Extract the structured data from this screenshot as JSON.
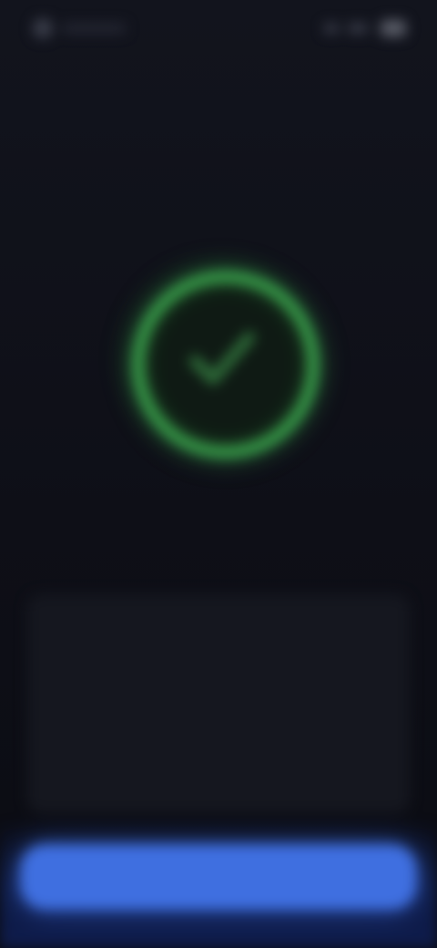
{
  "status_bar": {
    "time": "",
    "indicators": [
      "signal-icon",
      "wifi-icon",
      "battery-icon"
    ]
  },
  "header": {
    "title": ""
  },
  "status_indicator": {
    "icon": "check-circle-icon",
    "caption": ""
  },
  "info_card": {
    "heading": "",
    "body": "",
    "link": ""
  },
  "primary_action": {
    "label": ""
  },
  "colors": {
    "background": "#0e0f17",
    "success": "#3aa24c",
    "accent": "#3f6fe0",
    "card": "#15171f"
  }
}
